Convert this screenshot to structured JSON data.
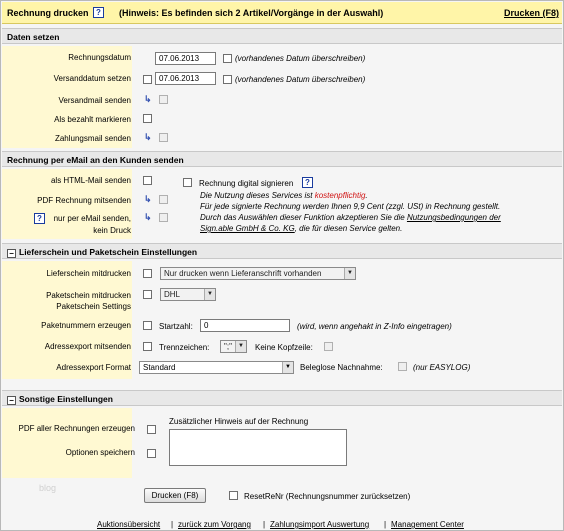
{
  "title": "Rechnung drucken",
  "hint": "(Hinweis: Es befinden sich 2 Artikel/Vorgänge in der Auswahl)",
  "print_link": "Drucken (F8)",
  "help_label": "?",
  "sections": {
    "daten": "Daten setzen",
    "email": "Rechnung per eMail an den Kunden senden",
    "liefer": "Lieferschein und Paketschein Einstellungen",
    "sonstige": "Sonstige Einstellungen"
  },
  "daten": {
    "rechnungsdatum_label": "Rechnungsdatum",
    "rechnungsdatum_value": "07.06.2013",
    "versanddatum_label": "Versanddatum setzen",
    "versanddatum_value": "07.06.2013",
    "overwrite_label": "(vorhandenes Datum überschreiben)",
    "versandmail_label": "Versandmail senden",
    "bezahlt_label": "Als bezahlt markieren",
    "zahlungsmail_label": "Zahlungsmail senden"
  },
  "email": {
    "html_label": "als HTML-Mail senden",
    "pdf_label": "PDF Rechnung mitsenden",
    "nur_label_1": "nur per eMail senden,",
    "nur_label_2": "kein Druck",
    "digital_label": "Rechnung digital signieren",
    "info_1a": "Die Nutzung dieses Services ist ",
    "info_1b": "kostenpflichtig",
    "info_1c": ".",
    "info_2": "Für jede signierte Rechnung werden Ihnen 9,9 Cent (zzgl. USt) in Rechnung gestellt.",
    "info_3a": "Durch das Auswählen dieser Funktion akzeptieren Sie die ",
    "info_3b": "Nutzungsbedingungen der",
    "info_4a": "Sign.able GmbH & Co. KG",
    "info_4b": ", die für diesen Service gelten."
  },
  "liefer": {
    "lieferschein_label": "Lieferschein mitdrucken",
    "lieferschein_select": "Nur drucken wenn Lieferanschrift vorhanden",
    "paket_label_1": "Paketschein mitdrucken",
    "paket_label_2": "Paketschein Settings",
    "paket_select": "DHL",
    "paketnr_label": "Paketnummern erzeugen",
    "startzahl_label": "Startzahl:",
    "startzahl_value": "0",
    "startzahl_note": "(wird, wenn angehakt in Z-Info eingetragen)",
    "adressexport_label": "Adressexport mitsenden",
    "trenn_label": "Trennzeichen:",
    "trenn_value": "\";\"",
    "kopf_label": "Keine Kopfzeile:",
    "format_label": "Adressexport Format",
    "format_value": "Standard",
    "beleglose_label": "Beleglose Nachnahme:",
    "easylog_label": "(nur EASYLOG)"
  },
  "sonstige": {
    "pdf_label": "PDF aller Rechnungen erzeugen",
    "optionen_label": "Optionen speichern",
    "hinweis_label": "Zusätzlicher Hinweis auf der Rechnung",
    "hinweis_value": ""
  },
  "watermark": "blog",
  "print_button": "Drucken (F8)",
  "reset_label": "ResetReNr (Rechnungsnummer zurücksetzen)",
  "footer_links": [
    "Auktionsübersicht",
    "zurück zum Vorgang",
    "Zahlungsimport Auswertung",
    "Management Center"
  ],
  "footer_sep": "|",
  "icons": {
    "arrow": "return-arrow-icon",
    "help": "help-icon",
    "collapse": "minus-icon"
  },
  "colors": {
    "titlebar": "#fff5a8",
    "label_bg": "#fff9d2",
    "section": "#e8e8e8",
    "link_blue": "#1a3c9e",
    "warning_red": "#d01010"
  }
}
